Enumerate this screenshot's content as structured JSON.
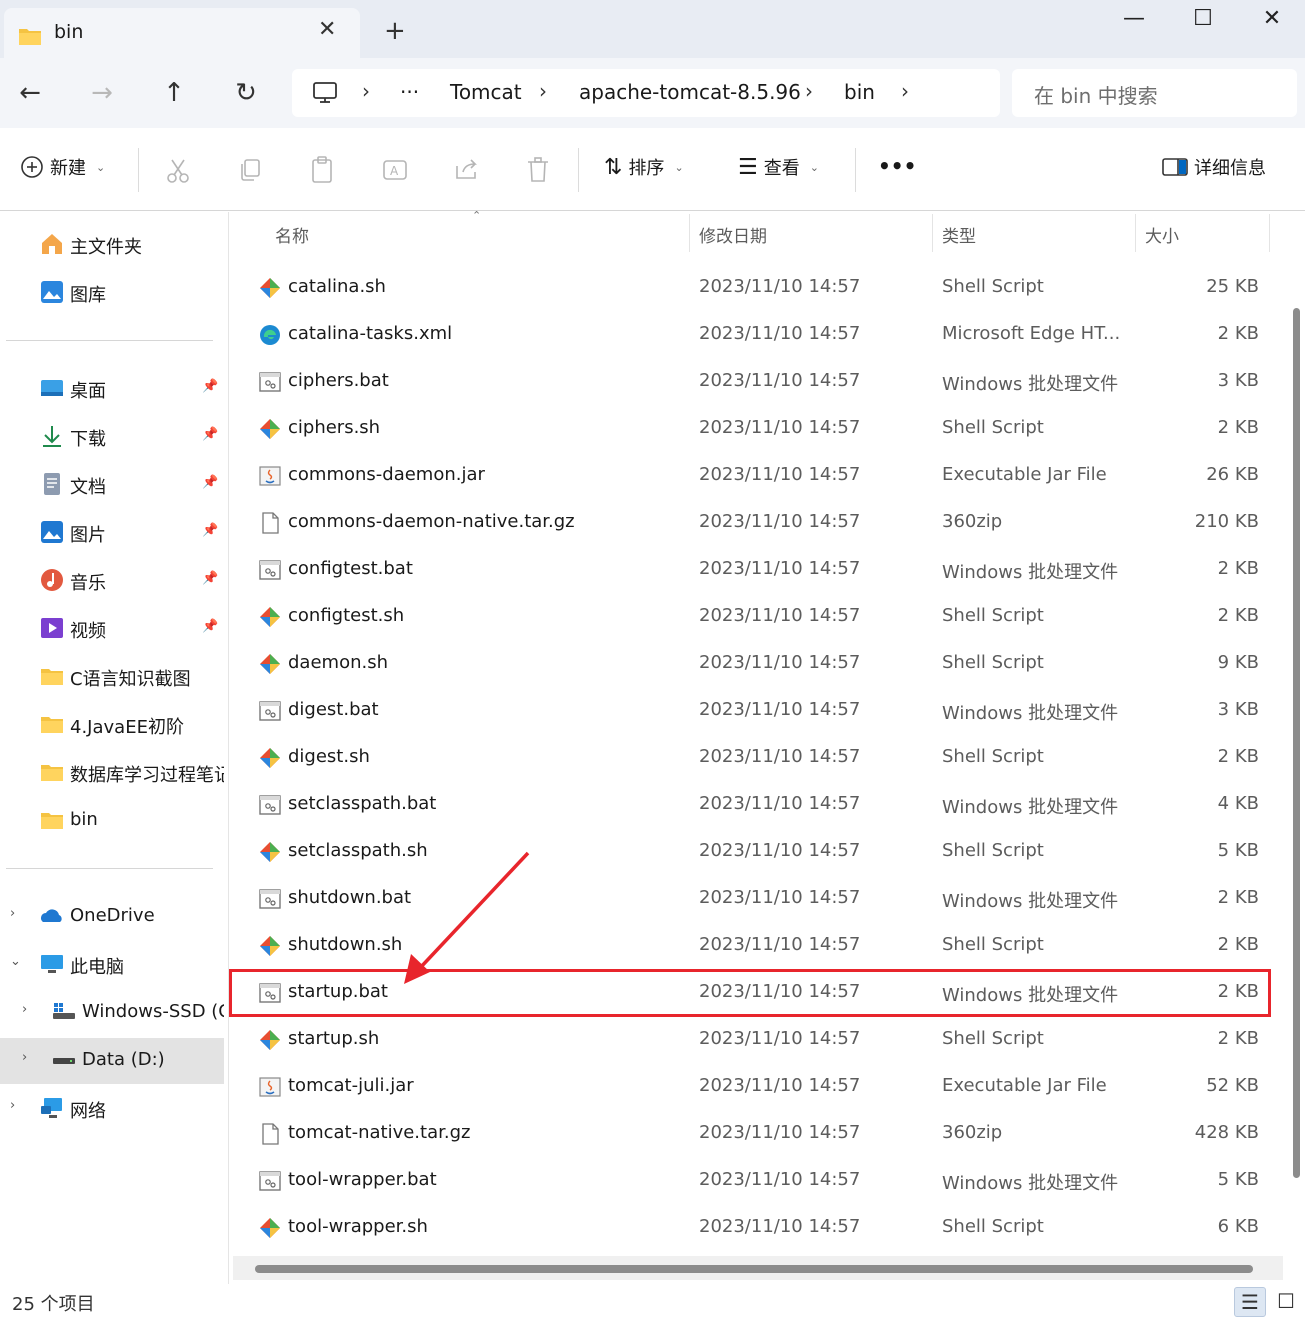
{
  "window": {
    "tab_title": "bin",
    "tab_close": "✕",
    "new_tab": "+",
    "minimize": "—",
    "maximize": "☐",
    "close": "✕"
  },
  "nav": {
    "back": "←",
    "forward": "→",
    "up": "↑",
    "refresh": "↻",
    "ellipsis": "···",
    "breadcrumbs": [
      "Tomcat",
      "apache-tomcat-8.5.96",
      "bin"
    ],
    "separator": "›",
    "search_placeholder": "在 bin 中搜索"
  },
  "toolbar": {
    "new_label": "新建",
    "sort_label": "排序",
    "view_label": "查看",
    "more": "•••",
    "details_label": "详细信息"
  },
  "sidebar": {
    "top": [
      {
        "label": "主文件夹",
        "icon": "home-icon"
      },
      {
        "label": "图库",
        "icon": "gallery-icon"
      }
    ],
    "quick": [
      {
        "label": "桌面",
        "icon": "desktop-icon",
        "pinned": true
      },
      {
        "label": "下载",
        "icon": "download-icon",
        "pinned": true
      },
      {
        "label": "文档",
        "icon": "documents-icon",
        "pinned": true
      },
      {
        "label": "图片",
        "icon": "pictures-icon",
        "pinned": true
      },
      {
        "label": "音乐",
        "icon": "music-icon",
        "pinned": true
      },
      {
        "label": "视频",
        "icon": "videos-icon",
        "pinned": true
      },
      {
        "label": "C语言知识截图",
        "icon": "folder-icon",
        "pinned": false
      },
      {
        "label": "4.JavaEE初阶",
        "icon": "folder-icon",
        "pinned": false
      },
      {
        "label": "数据库学习过程笔记",
        "icon": "folder-icon",
        "pinned": false
      },
      {
        "label": "bin",
        "icon": "folder-icon",
        "pinned": false
      }
    ],
    "pin_glyph": "📌",
    "tree": [
      {
        "label": "OneDrive",
        "icon": "onedrive-icon",
        "chev": "›"
      },
      {
        "label": "此电脑",
        "icon": "pc-icon",
        "chev": "⌄"
      },
      {
        "label": "Windows-SSD (C:)",
        "icon": "drive-icon",
        "chev": "›"
      },
      {
        "label": "Data (D:)",
        "icon": "drive-icon",
        "chev": "›"
      },
      {
        "label": "网络",
        "icon": "network-icon",
        "chev": "›"
      }
    ]
  },
  "columns": {
    "name": "名称",
    "date": "修改日期",
    "type": "类型",
    "size": "大小"
  },
  "files": [
    {
      "name": "catalina.sh",
      "date": "2023/11/10 14:57",
      "type": "Shell Script",
      "size": "25 KB",
      "icon": "git-script-icon"
    },
    {
      "name": "catalina-tasks.xml",
      "date": "2023/11/10 14:57",
      "type": "Microsoft Edge HT...",
      "size": "2 KB",
      "icon": "edge-icon"
    },
    {
      "name": "ciphers.bat",
      "date": "2023/11/10 14:57",
      "type": "Windows 批处理文件",
      "size": "3 KB",
      "icon": "batch-file-icon"
    },
    {
      "name": "ciphers.sh",
      "date": "2023/11/10 14:57",
      "type": "Shell Script",
      "size": "2 KB",
      "icon": "git-script-icon"
    },
    {
      "name": "commons-daemon.jar",
      "date": "2023/11/10 14:57",
      "type": "Executable Jar File",
      "size": "26 KB",
      "icon": "jar-icon"
    },
    {
      "name": "commons-daemon-native.tar.gz",
      "date": "2023/11/10 14:57",
      "type": "360zip",
      "size": "210 KB",
      "icon": "blank-file-icon"
    },
    {
      "name": "configtest.bat",
      "date": "2023/11/10 14:57",
      "type": "Windows 批处理文件",
      "size": "2 KB",
      "icon": "batch-file-icon"
    },
    {
      "name": "configtest.sh",
      "date": "2023/11/10 14:57",
      "type": "Shell Script",
      "size": "2 KB",
      "icon": "git-script-icon"
    },
    {
      "name": "daemon.sh",
      "date": "2023/11/10 14:57",
      "type": "Shell Script",
      "size": "9 KB",
      "icon": "git-script-icon"
    },
    {
      "name": "digest.bat",
      "date": "2023/11/10 14:57",
      "type": "Windows 批处理文件",
      "size": "3 KB",
      "icon": "batch-file-icon"
    },
    {
      "name": "digest.sh",
      "date": "2023/11/10 14:57",
      "type": "Shell Script",
      "size": "2 KB",
      "icon": "git-script-icon"
    },
    {
      "name": "setclasspath.bat",
      "date": "2023/11/10 14:57",
      "type": "Windows 批处理文件",
      "size": "4 KB",
      "icon": "batch-file-icon"
    },
    {
      "name": "setclasspath.sh",
      "date": "2023/11/10 14:57",
      "type": "Shell Script",
      "size": "5 KB",
      "icon": "git-script-icon"
    },
    {
      "name": "shutdown.bat",
      "date": "2023/11/10 14:57",
      "type": "Windows 批处理文件",
      "size": "2 KB",
      "icon": "batch-file-icon"
    },
    {
      "name": "shutdown.sh",
      "date": "2023/11/10 14:57",
      "type": "Shell Script",
      "size": "2 KB",
      "icon": "git-script-icon"
    },
    {
      "name": "startup.bat",
      "date": "2023/11/10 14:57",
      "type": "Windows 批处理文件",
      "size": "2 KB",
      "icon": "batch-file-icon",
      "highlighted": true
    },
    {
      "name": "startup.sh",
      "date": "2023/11/10 14:57",
      "type": "Shell Script",
      "size": "2 KB",
      "icon": "git-script-icon"
    },
    {
      "name": "tomcat-juli.jar",
      "date": "2023/11/10 14:57",
      "type": "Executable Jar File",
      "size": "52 KB",
      "icon": "jar-icon"
    },
    {
      "name": "tomcat-native.tar.gz",
      "date": "2023/11/10 14:57",
      "type": "360zip",
      "size": "428 KB",
      "icon": "blank-file-icon"
    },
    {
      "name": "tool-wrapper.bat",
      "date": "2023/11/10 14:57",
      "type": "Windows 批处理文件",
      "size": "5 KB",
      "icon": "batch-file-icon"
    },
    {
      "name": "tool-wrapper.sh",
      "date": "2023/11/10 14:57",
      "type": "Shell Script",
      "size": "6 KB",
      "icon": "git-script-icon"
    }
  ],
  "status": {
    "item_count": "25 个项目"
  },
  "colors": {
    "highlight": "#e8252c",
    "accent": "#0067c0",
    "folder": "#f5c342"
  }
}
